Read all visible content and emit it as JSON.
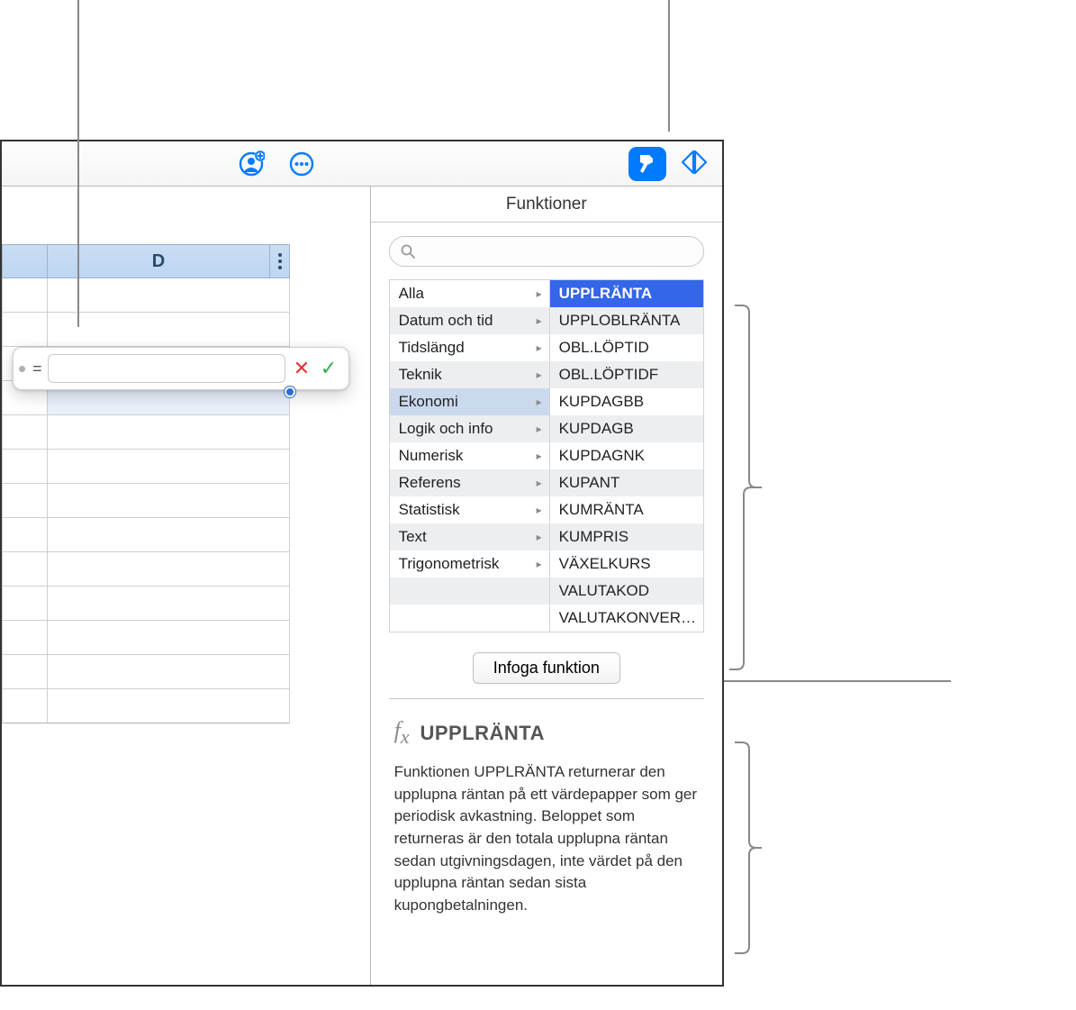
{
  "toolbar": {
    "collab_icon": "collab-icon",
    "more_icon": "more-icon",
    "format_icon": "format-brush-icon",
    "organize_icon": "organize-icon"
  },
  "sheet": {
    "column_label": "D"
  },
  "formula": {
    "equals": "=",
    "value": ""
  },
  "sidebar": {
    "title": "Funktioner",
    "search_placeholder": "",
    "categories": [
      {
        "label": "Alla",
        "selected": false
      },
      {
        "label": "Datum och tid",
        "selected": false
      },
      {
        "label": "Tidslängd",
        "selected": false
      },
      {
        "label": "Teknik",
        "selected": false
      },
      {
        "label": "Ekonomi",
        "selected": true
      },
      {
        "label": "Logik och info",
        "selected": false
      },
      {
        "label": "Numerisk",
        "selected": false
      },
      {
        "label": "Referens",
        "selected": false
      },
      {
        "label": "Statistisk",
        "selected": false
      },
      {
        "label": "Text",
        "selected": false
      },
      {
        "label": "Trigonometrisk",
        "selected": false
      }
    ],
    "functions": [
      {
        "label": "UPPLRÄNTA",
        "selected": true
      },
      {
        "label": "UPPLOBLRÄNTA",
        "selected": false
      },
      {
        "label": "OBL.LÖPTID",
        "selected": false
      },
      {
        "label": "OBL.LÖPTIDF",
        "selected": false
      },
      {
        "label": "KUPDAGBB",
        "selected": false
      },
      {
        "label": "KUPDAGB",
        "selected": false
      },
      {
        "label": "KUPDAGNK",
        "selected": false
      },
      {
        "label": "KUPANT",
        "selected": false
      },
      {
        "label": "KUMRÄNTA",
        "selected": false
      },
      {
        "label": "KUMPRIS",
        "selected": false
      },
      {
        "label": "VÄXELKURS",
        "selected": false
      },
      {
        "label": "VALUTAKOD",
        "selected": false
      },
      {
        "label": "VALUTAKONVER…",
        "selected": false
      }
    ],
    "insert_label": "Infoga funktion",
    "detail": {
      "name": "UPPLRÄNTA",
      "description": "Funktionen UPPLRÄNTA returnerar den upplupna räntan på ett värdepapper som ger periodisk avkastning. Beloppet som returneras är den totala upplupna räntan sedan utgivningsdagen, inte värdet på den upplupna räntan sedan sista kupongbetalningen."
    }
  }
}
